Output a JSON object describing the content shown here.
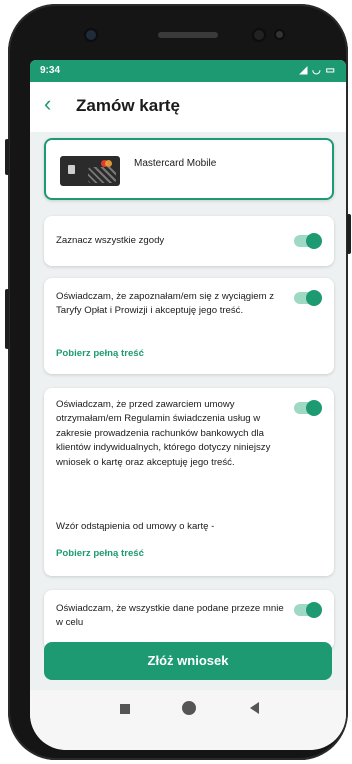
{
  "status_bar": {
    "time": "9:34",
    "icons": "◢ ◡ ▭"
  },
  "header": {
    "back_glyph": "‹",
    "title": "Zamów kartę"
  },
  "card_option": {
    "name": "Mastercard Mobile"
  },
  "consents": [
    {
      "text": "Zaznacz wszystkie zgody",
      "checked": true
    },
    {
      "text": "Oświadczam, że zapoznałam/em się z wyciągiem z Taryfy Opłat i Prowizji i akceptuję jego treść.",
      "link": "Pobierz pełną treść",
      "checked": true
    },
    {
      "text": "Oświadczam, że przed zawarciem umowy otrzymałam/em Regulamin świadczenia usług w zakresie prowadzenia rachunków bankowych dla klientów indywidualnych, którego dotyczy niniejszy wniosek o kartę oraz akceptuję jego treść.",
      "extra": "Wzór odstąpienia od umowy o kartę -",
      "link": "Pobierz pełną treść",
      "checked": true
    },
    {
      "text": "Oświadczam, że wszystkie dane podane przeze mnie w celu",
      "checked": true
    }
  ],
  "submit_button": {
    "label": "Złóż wniosek"
  },
  "colors": {
    "accent": "#1e9a73",
    "status_bar": "#1e9a73",
    "background": "#eef1f1"
  }
}
